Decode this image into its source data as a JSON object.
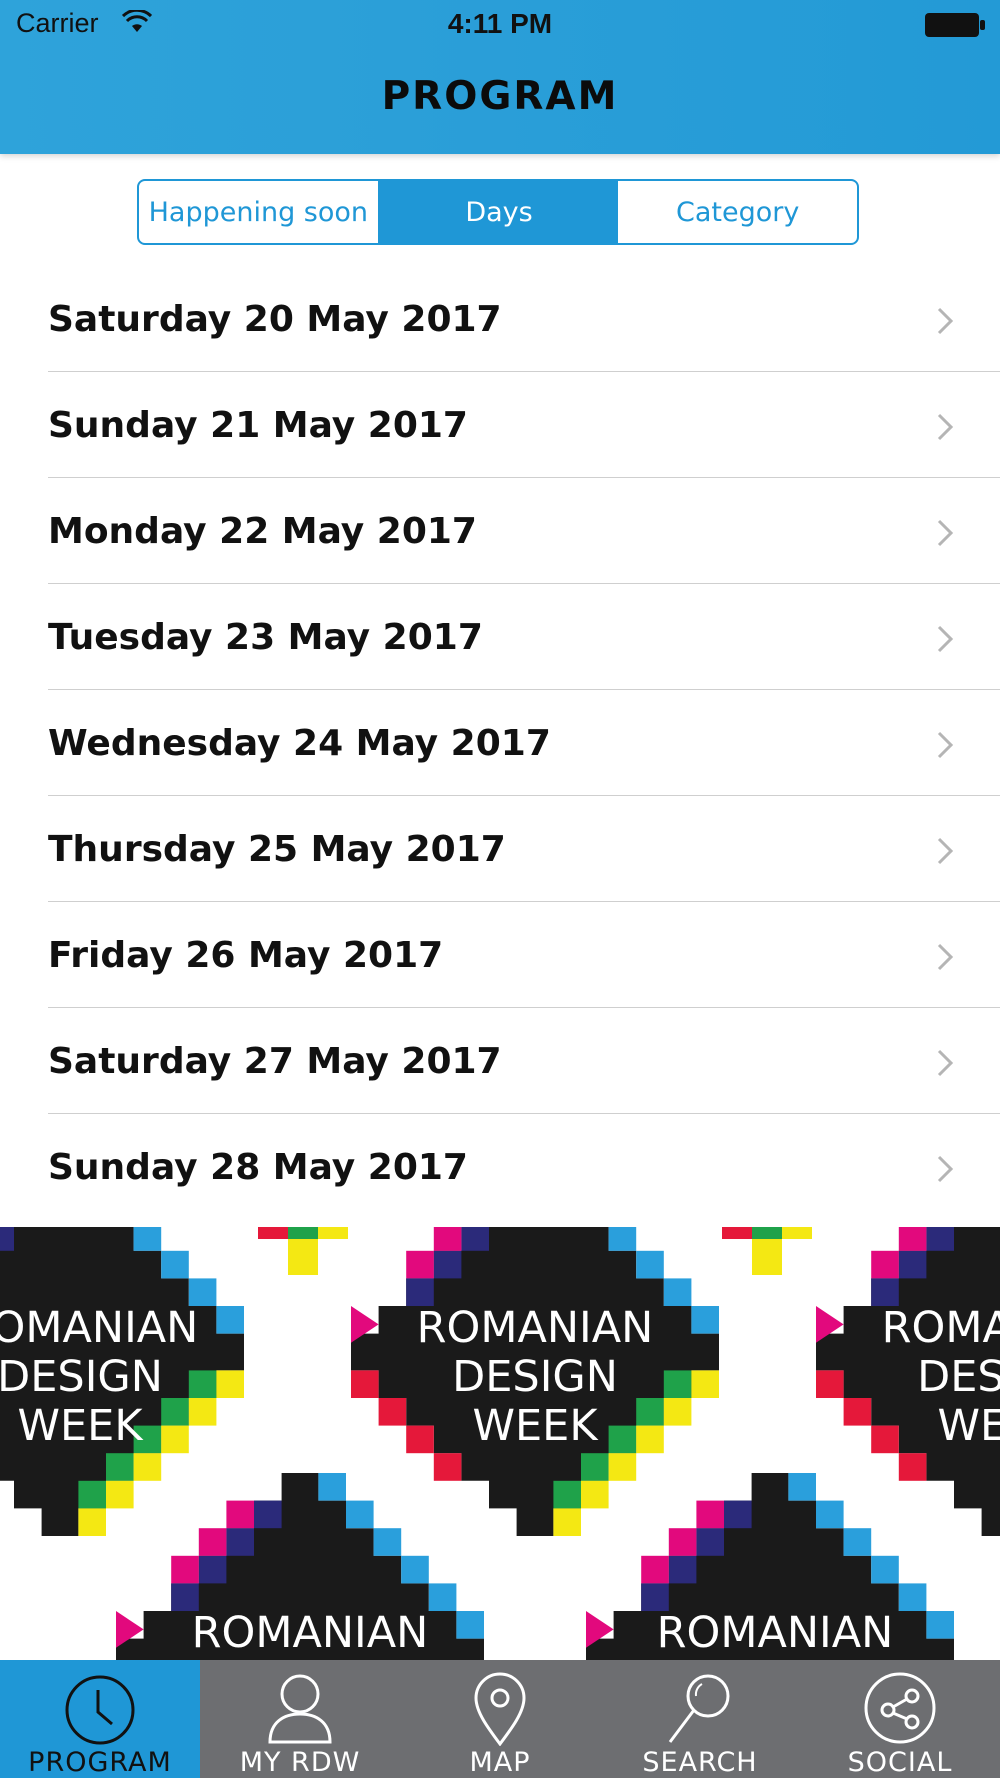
{
  "status_bar": {
    "carrier": "Carrier",
    "time": "4:11 PM"
  },
  "nav": {
    "title": "PROGRAM"
  },
  "segments": [
    {
      "label": "Happening soon",
      "selected": false
    },
    {
      "label": "Days",
      "selected": true
    },
    {
      "label": "Category",
      "selected": false
    }
  ],
  "days": [
    "Saturday 20 May 2017",
    "Sunday 21 May 2017",
    "Monday 22 May 2017",
    "Tuesday 23 May 2017",
    "Wednesday 24 May 2017",
    "Thursday 25 May 2017",
    "Friday 26 May 2017",
    "Saturday 27 May 2017",
    "Sunday 28 May 2017"
  ],
  "banner": {
    "logo_lines": [
      "ROMANIAN",
      "DESIGN",
      "WEEK"
    ],
    "colors": {
      "black": "#1a1a1a",
      "blue": "#2a9fdc",
      "navy": "#2b2a7a",
      "magenta": "#e2097d",
      "red": "#e5183a",
      "green": "#1fa24a",
      "yellow": "#f4e813"
    }
  },
  "tabs": [
    {
      "label": "PROGRAM",
      "icon": "clock-icon",
      "selected": true
    },
    {
      "label": "MY RDW",
      "icon": "person-icon",
      "selected": false
    },
    {
      "label": "MAP",
      "icon": "map-pin-icon",
      "selected": false
    },
    {
      "label": "SEARCH",
      "icon": "search-icon",
      "selected": false
    },
    {
      "label": "SOCIAL",
      "icon": "share-icon",
      "selected": false
    }
  ],
  "colors": {
    "accent": "#1f97d6",
    "tab_bar": "#6d6e71"
  }
}
